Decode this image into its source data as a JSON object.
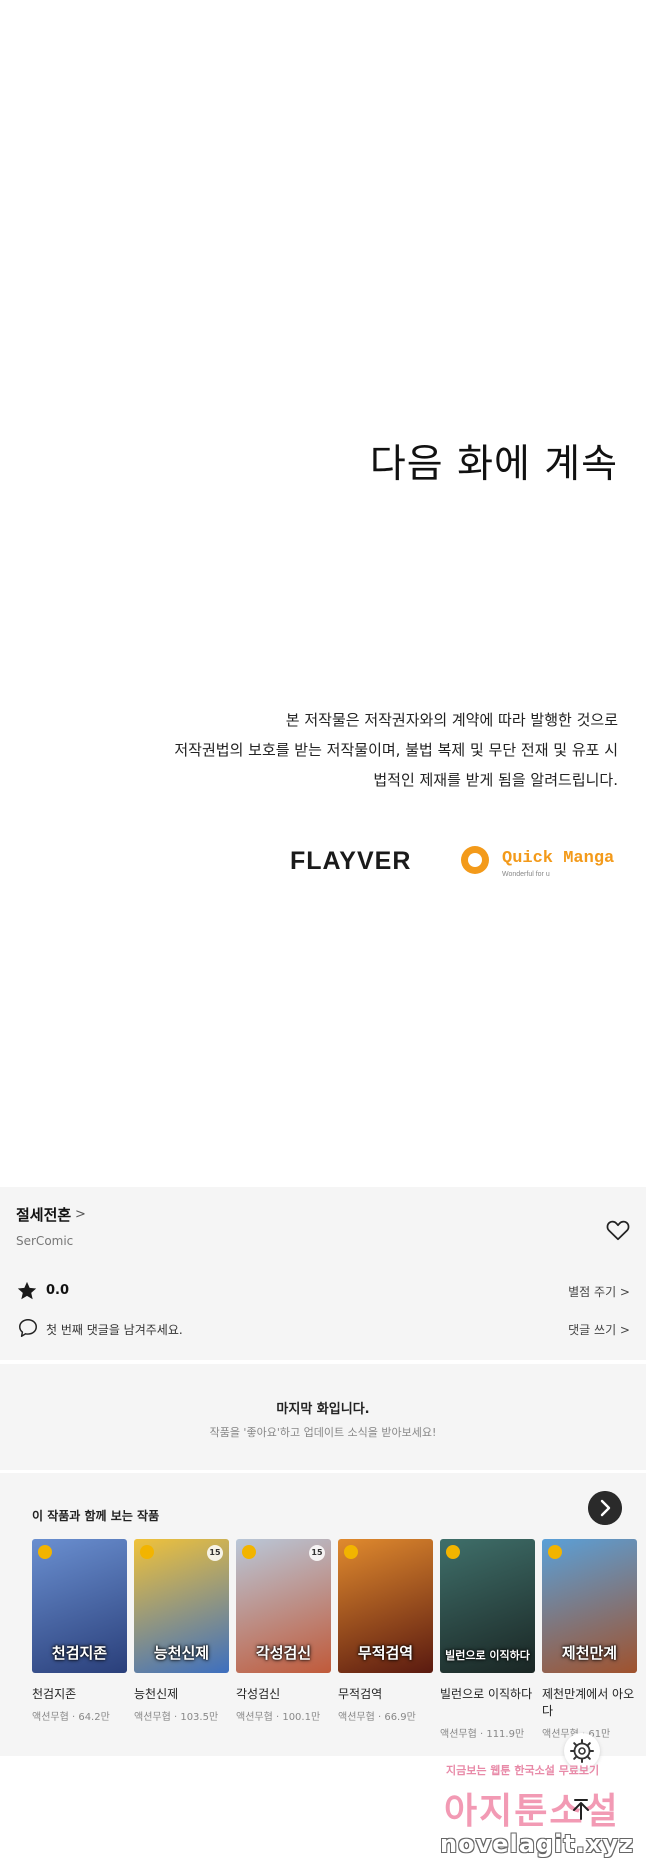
{
  "episode_end": {
    "continue_text": "다음 화에 계속",
    "notice_lines": [
      "본 저작물은 저작권자와의 계약에 따라 발행한 것으로",
      "저작권법의 보호를 받는 저작물이며, 불법 복제 및 무단 전재 및 유포 시",
      "법적인 제재를 받게 됨을 알려드립니다."
    ],
    "logos": {
      "flayver": "FLAYVER",
      "quick_manga": "Quick Manga",
      "quick_manga_tagline": "Wonderful for u"
    }
  },
  "series_info": {
    "title": "절세전혼",
    "title_chevron": ">",
    "author": "SerComic",
    "rating_value": "0.0",
    "rate_link": "별점 주기 >",
    "comment_prompt": "첫 번째 댓글을 남겨주세요.",
    "comment_link": "댓글 쓰기 >",
    "icons": {
      "favorite": "heart-icon",
      "rating": "star-icon",
      "comment": "speech-bubble-icon"
    }
  },
  "last_episode": {
    "title": "마지막 화입니다.",
    "subtitle": "작품을 '좋아요'하고 업데이트 소식을 받아보세요!"
  },
  "recommendations": {
    "heading": "이 작품과 함께 보는 작품",
    "items": [
      {
        "name": "천검지존",
        "meta": "액션무협 · 64.2만",
        "cover_text": "천검지존",
        "age_badge": "",
        "colors": [
          "#6a8fd0",
          "#2a3f7a"
        ]
      },
      {
        "name": "능천신제",
        "meta": "액션무협 · 103.5만",
        "cover_text": "능천신제",
        "age_badge": "15",
        "colors": [
          "#f0c23a",
          "#3d6fbf"
        ]
      },
      {
        "name": "각성검신",
        "meta": "액션무협 · 100.1만",
        "cover_text": "각성검신",
        "age_badge": "15",
        "colors": [
          "#b9c7d8",
          "#c05a3a"
        ]
      },
      {
        "name": "무적검역",
        "meta": "액션무협 · 66.9만",
        "cover_text": "무적검역",
        "age_badge": "",
        "colors": [
          "#e08a2e",
          "#5a1a10"
        ]
      },
      {
        "name": "빌런으로 이직하다",
        "meta": "액션무협 · 111.9만",
        "cover_text": "빌런으로 이직하다",
        "age_badge": "",
        "colors": [
          "#3f6f6a",
          "#1a2624"
        ]
      },
      {
        "name": "제천만계에서 아오다",
        "meta": "액션무협 · 61만",
        "cover_text": "제천만계",
        "age_badge": "",
        "colors": [
          "#5aa0d8",
          "#a0522d"
        ]
      }
    ]
  },
  "watermark": {
    "top_text": "지금보는 웹툰 한국소설 무료보기",
    "main_text": "아지툰소설",
    "url_text": "novelagit.xyz"
  },
  "colors": {
    "panel_bg": "#f5f5f5",
    "badge_yellow": "#f2b400",
    "watermark_pink": "#f29ab4"
  }
}
